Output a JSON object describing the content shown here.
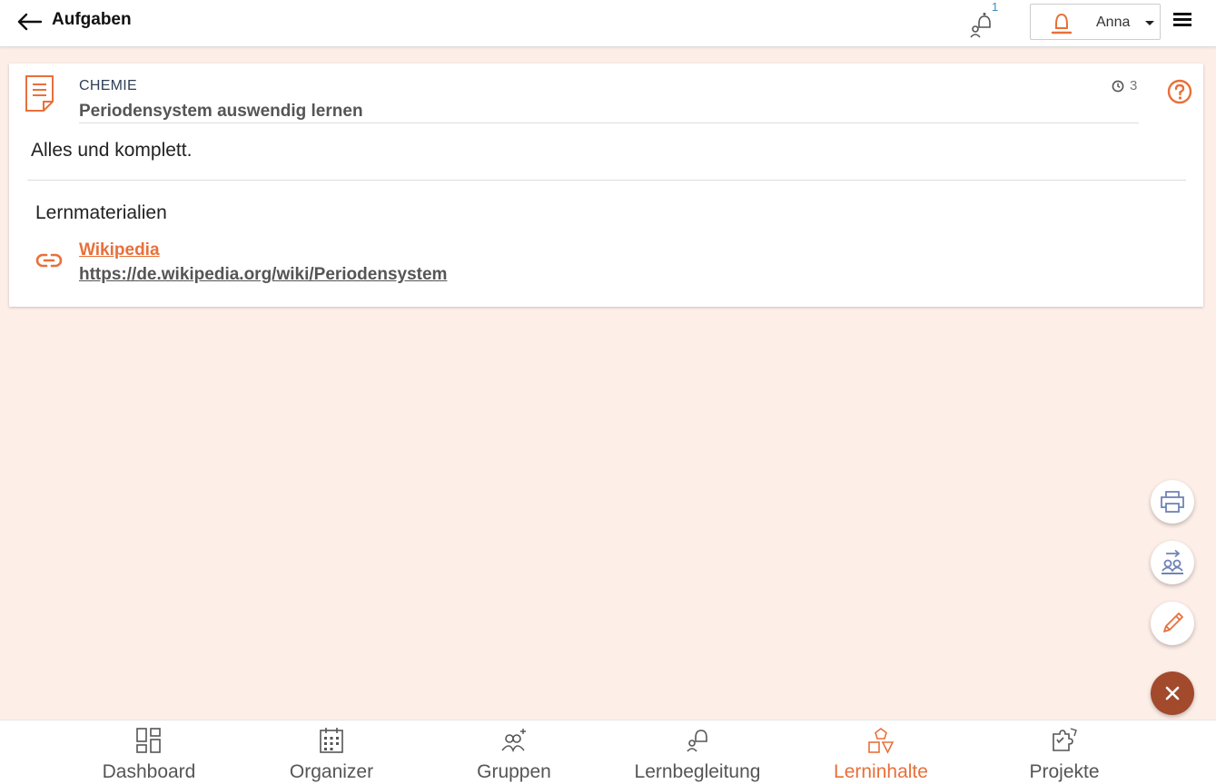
{
  "header": {
    "title": "Aufgaben",
    "notification_count": "1",
    "user_name": "Anna"
  },
  "task": {
    "subject": "CHEMIE",
    "title": "Periodensystem auswendig lernen",
    "time_value": "3",
    "description": "Alles und komplett.",
    "materials_heading": "Lernmaterialien",
    "materials": [
      {
        "title": "Wikipedia",
        "url": "https://de.wikipedia.org/wiki/Periodensystem"
      }
    ]
  },
  "nav": {
    "items": [
      {
        "label": "Dashboard",
        "icon": "dashboard-icon"
      },
      {
        "label": "Organizer",
        "icon": "calendar-icon"
      },
      {
        "label": "Gruppen",
        "icon": "groups-icon"
      },
      {
        "label": "Lernbegleitung",
        "icon": "mentoring-icon"
      },
      {
        "label": "Lerninhalte",
        "icon": "shapes-icon",
        "active": true
      },
      {
        "label": "Projekte",
        "icon": "puzzle-icon"
      }
    ]
  },
  "colors": {
    "accent": "#e8703a",
    "background": "#fdeee8",
    "fab_close": "#a34a2c",
    "fab_icon": "#6f84b6",
    "notification": "#3a8dbd"
  }
}
